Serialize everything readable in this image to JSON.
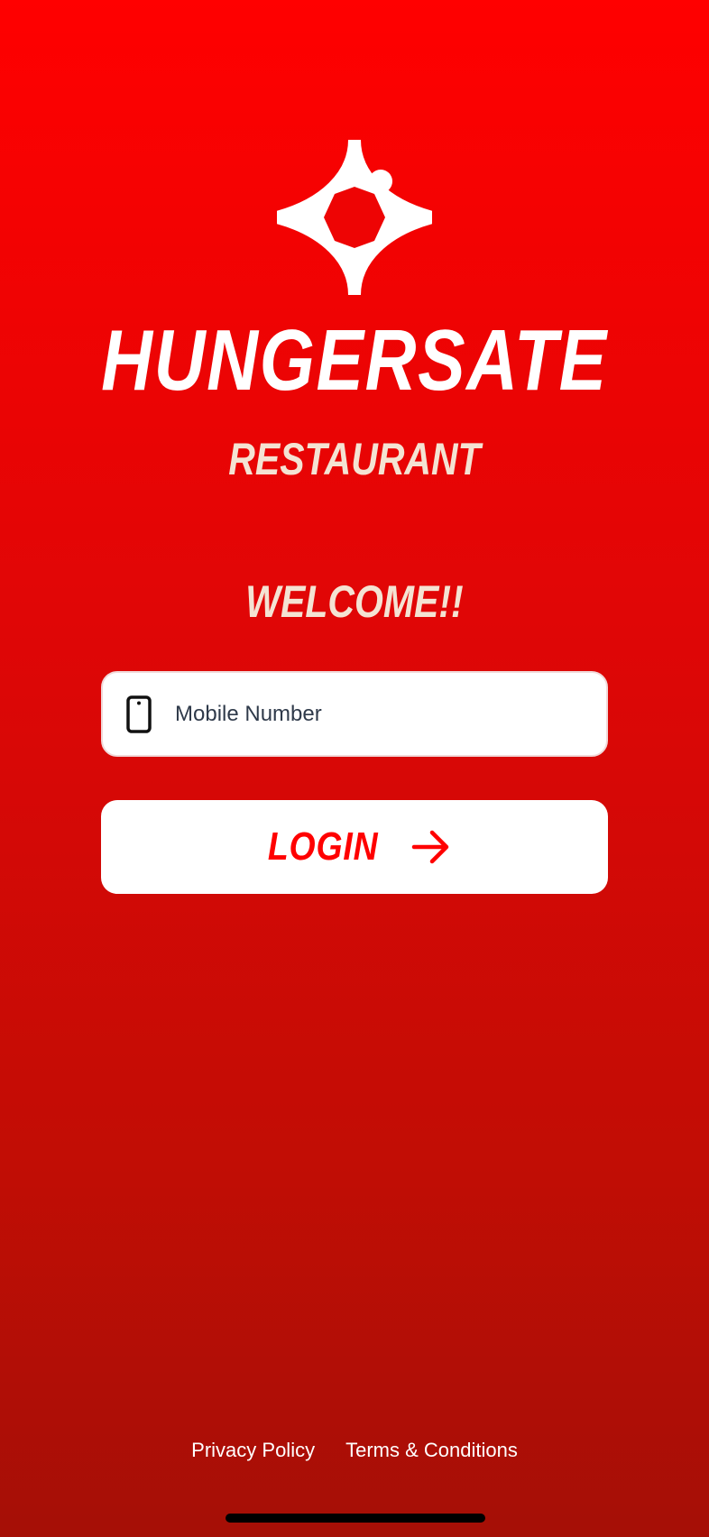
{
  "brand": {
    "name": "HUNGERSATE",
    "subtitle": "RESTAURANT",
    "logo_icon": "star-sparkle-logo-icon"
  },
  "welcome_text": "WELCOME!!",
  "mobile_field": {
    "placeholder": "Mobile Number",
    "value": "",
    "icon": "phone-icon"
  },
  "login_button": {
    "label": "LOGIN",
    "icon": "arrow-right-icon"
  },
  "footer": {
    "privacy": "Privacy Policy",
    "terms": "Terms & Conditions"
  },
  "colors": {
    "background_top": "#ff0000",
    "background_bottom": "#a50f06",
    "accent": "#ff0000",
    "cream_text": "#f4e3d3",
    "white": "#ffffff"
  }
}
